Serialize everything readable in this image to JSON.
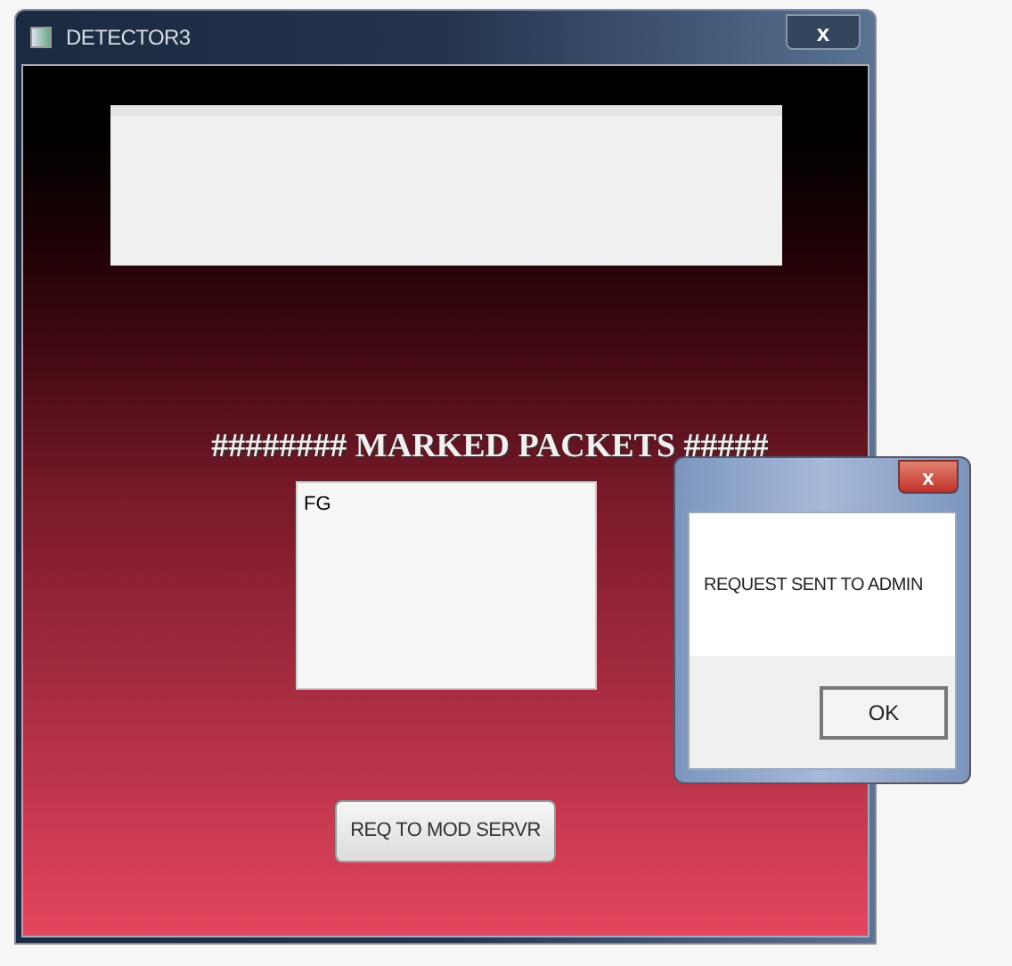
{
  "window": {
    "title": "DETECTOR3",
    "close": "x"
  },
  "heading": "######## MARKED PACKETS #####",
  "packets": {
    "value": "FG"
  },
  "button": "REQ TO MOD SERVR",
  "dialog": {
    "close": "x",
    "message": "REQUEST SENT TO ADMIN",
    "button": "OK"
  }
}
